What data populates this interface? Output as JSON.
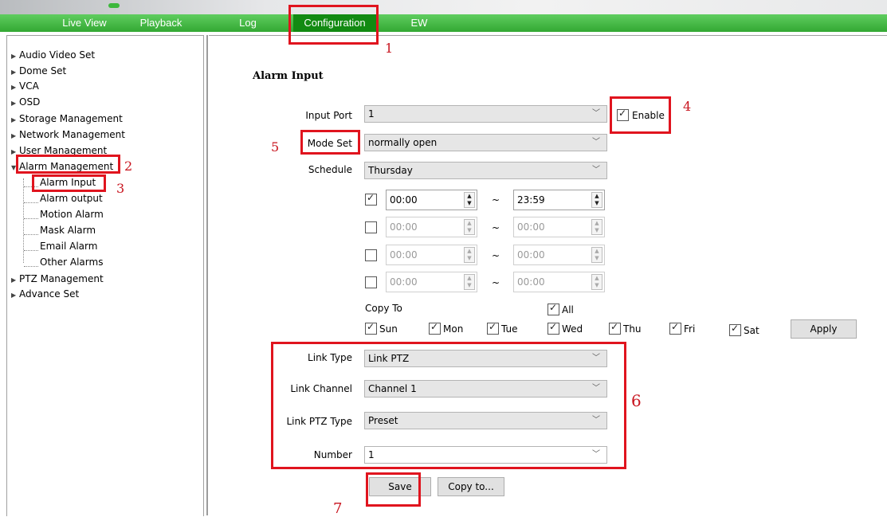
{
  "nav": {
    "tabs": [
      {
        "label": "Live View"
      },
      {
        "label": "Playback"
      },
      {
        "label": "Log"
      },
      {
        "label": "Configuration"
      },
      {
        "label": "EW"
      }
    ],
    "active": "Configuration"
  },
  "sidebar": {
    "items": [
      {
        "label": "Audio Video Set"
      },
      {
        "label": "Dome Set"
      },
      {
        "label": "VCA"
      },
      {
        "label": "OSD"
      },
      {
        "label": "Storage Management"
      },
      {
        "label": "Network Management"
      },
      {
        "label": "User Management"
      },
      {
        "label": "Alarm Management"
      },
      {
        "label": "PTZ Management"
      },
      {
        "label": "Advance Set"
      }
    ],
    "alarm_sub": [
      {
        "label": "Alarm Input"
      },
      {
        "label": "Alarm output"
      },
      {
        "label": "Motion Alarm"
      },
      {
        "label": "Mask Alarm"
      },
      {
        "label": "Email Alarm"
      },
      {
        "label": "Other Alarms"
      }
    ]
  },
  "main": {
    "title": "Alarm Input",
    "input_port": {
      "label": "Input Port",
      "value": "1"
    },
    "enable": {
      "label": "Enable",
      "checked": true
    },
    "mode_set": {
      "label": "Mode Set",
      "value": "normally open"
    },
    "schedule": {
      "label": "Schedule",
      "value": "Thursday"
    },
    "time_slots": [
      {
        "checked": true,
        "start": "00:00",
        "end": "23:59"
      },
      {
        "checked": false,
        "start": "00:00",
        "end": "00:00"
      },
      {
        "checked": false,
        "start": "00:00",
        "end": "00:00"
      },
      {
        "checked": false,
        "start": "00:00",
        "end": "00:00"
      }
    ],
    "tilde": "~",
    "copy_to": {
      "label": "Copy To",
      "all_label": "All"
    },
    "days": [
      "Sun",
      "Mon",
      "Tue",
      "Wed",
      "Thu",
      "Fri",
      "Sat"
    ],
    "apply_label": "Apply",
    "link_type": {
      "label": "Link Type",
      "value": "Link PTZ"
    },
    "link_channel": {
      "label": "Link Channel",
      "value": "Channel 1"
    },
    "link_ptz_type": {
      "label": "Link PTZ Type",
      "value": "Preset"
    },
    "number": {
      "label": "Number",
      "value": "1"
    },
    "save_label": "Save",
    "copy_to_button": "Copy to..."
  },
  "annotations": [
    "1",
    "2",
    "3",
    "4",
    "5",
    "6",
    "7"
  ],
  "colors": {
    "nav_green": "#33a833",
    "nav_active": "#128a12",
    "annotation_red": "#e0141e"
  }
}
